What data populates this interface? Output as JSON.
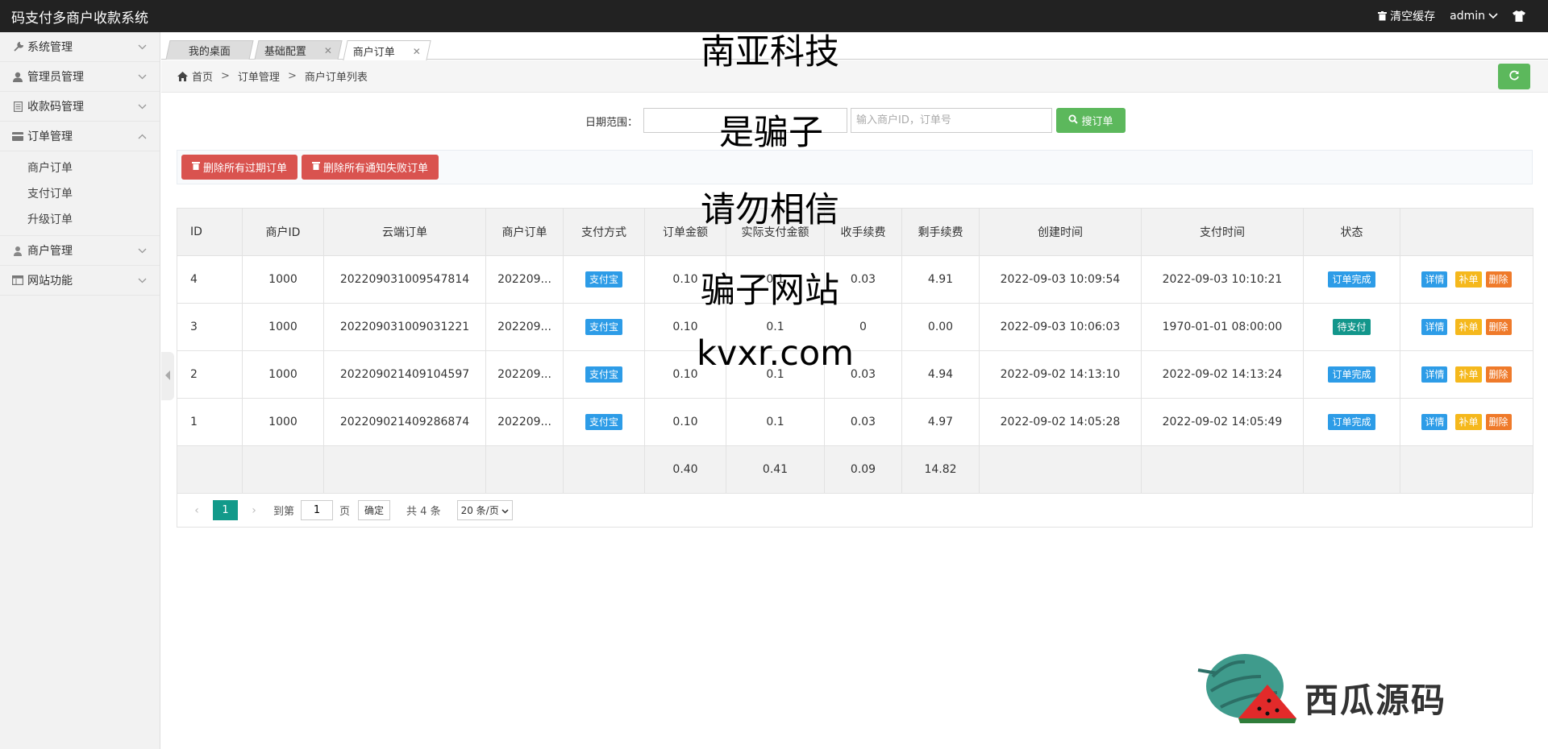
{
  "app": {
    "title": "码支付多商户收款系统"
  },
  "topbar": {
    "clear_cache": "清空缓存",
    "user": "admin"
  },
  "sidebar": {
    "items": [
      {
        "label": "系统管理",
        "icon": "wrench-icon",
        "expanded": false
      },
      {
        "label": "管理员管理",
        "icon": "user-icon",
        "expanded": false
      },
      {
        "label": "收款码管理",
        "icon": "document-icon",
        "expanded": false
      },
      {
        "label": "订单管理",
        "icon": "card-icon",
        "expanded": true,
        "children": [
          "商户订单",
          "支付订单",
          "升级订单"
        ]
      },
      {
        "label": "商户管理",
        "icon": "merchant-icon",
        "expanded": false
      },
      {
        "label": "网站功能",
        "icon": "window-icon",
        "expanded": false
      }
    ]
  },
  "tabs": [
    {
      "label": "我的桌面",
      "closable": false,
      "active": false
    },
    {
      "label": "基础配置",
      "closable": true,
      "active": false
    },
    {
      "label": "商户订单",
      "closable": true,
      "active": true
    }
  ],
  "breadcrumb": [
    "首页",
    "订单管理",
    "商户订单列表"
  ],
  "search": {
    "date_label": "日期范围：",
    "date_value": "",
    "keyword_placeholder": "输入商户ID，订单号",
    "button": "搜订单"
  },
  "toolbar": {
    "delete_expired": "删除所有过期订单",
    "delete_failed": "删除所有通知失败订单"
  },
  "table": {
    "columns": [
      "ID",
      "商户ID",
      "云端订单",
      "商户订单",
      "支付方式",
      "订单金额",
      "实际支付金额",
      "收手续费",
      "剩手续费",
      "创建时间",
      "支付时间",
      "状态",
      ""
    ],
    "rows": [
      {
        "id": "4",
        "merchant": "1000",
        "cloud": "202209031009547814",
        "morder": "202209...",
        "pay": "支付宝",
        "amount": "0.10",
        "actual": "0.1",
        "fee": "0.03",
        "remain": "4.91",
        "created": "2022-09-03 10:09:54",
        "paid": "2022-09-03 10:10:21",
        "status": "订单完成",
        "status_color": "blue"
      },
      {
        "id": "3",
        "merchant": "1000",
        "cloud": "202209031009031221",
        "morder": "202209...",
        "pay": "支付宝",
        "amount": "0.10",
        "actual": "0.1",
        "fee": "0",
        "remain": "0.00",
        "created": "2022-09-03 10:06:03",
        "paid": "1970-01-01 08:00:00",
        "status": "待支付",
        "status_color": "teal"
      },
      {
        "id": "2",
        "merchant": "1000",
        "cloud": "202209021409104597",
        "morder": "202209...",
        "pay": "支付宝",
        "amount": "0.10",
        "actual": "0.1",
        "fee": "0.03",
        "remain": "4.94",
        "created": "2022-09-02 14:13:10",
        "paid": "2022-09-02 14:13:24",
        "status": "订单完成",
        "status_color": "blue"
      },
      {
        "id": "1",
        "merchant": "1000",
        "cloud": "202209021409286874",
        "morder": "202209...",
        "pay": "支付宝",
        "amount": "0.10",
        "actual": "0.1",
        "fee": "0.03",
        "remain": "4.97",
        "created": "2022-09-02 14:05:28",
        "paid": "2022-09-02 14:05:49",
        "status": "订单完成",
        "status_color": "blue"
      }
    ],
    "actions": [
      "详情",
      "补单",
      "删除"
    ],
    "totals": {
      "amount": "0.40",
      "actual": "0.41",
      "fee": "0.09",
      "remain": "14.82"
    }
  },
  "pager": {
    "current": "1",
    "goto_label": "到第",
    "goto_value": "1",
    "page_unit": "页",
    "confirm": "确定",
    "total": "共 4 条",
    "page_size": "20 条/页"
  },
  "overlay_text": [
    "南亚科技",
    "是骗子",
    "请勿相信",
    "骗子网站",
    "kvxr.com"
  ],
  "watermark": {
    "text": "西瓜源码"
  },
  "colors": {
    "topbar": "#222222",
    "success": "#5cb85c",
    "danger": "#d9534f",
    "primary": "#2d9ce7",
    "teal": "#12968b",
    "warning": "#f5b81c",
    "orange": "#ef7a2a"
  }
}
